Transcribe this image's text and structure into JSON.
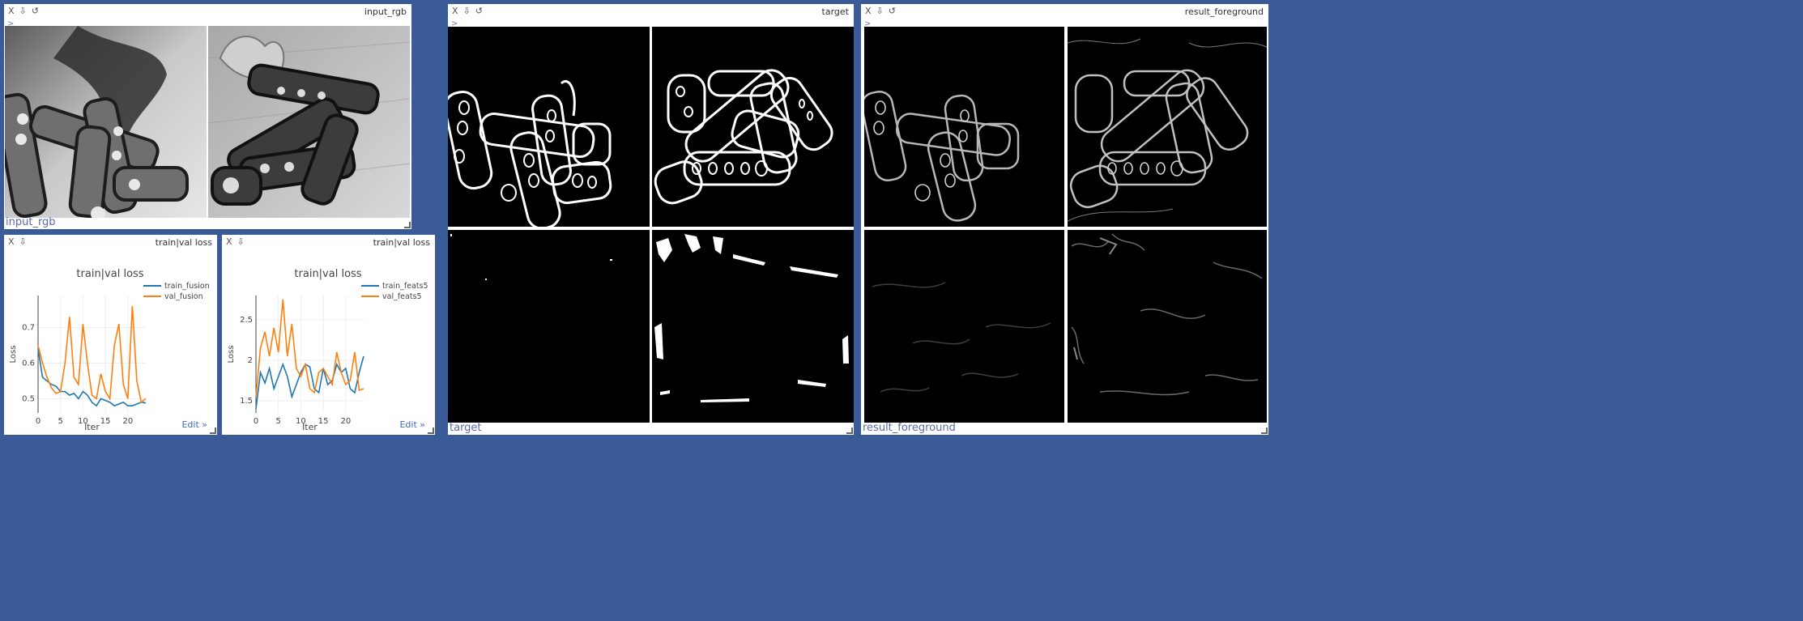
{
  "controls": {
    "close": "X",
    "download": "⇩",
    "reset": "↺",
    "expand": ">"
  },
  "panes": {
    "input_rgb": {
      "title": "input_rgb",
      "caption": "input_rgb"
    },
    "target": {
      "title": "target",
      "caption": "target"
    },
    "result_foreground": {
      "title": "result_foreground",
      "caption": "result_foreground"
    },
    "loss_fusion": {
      "title": "train|val loss",
      "edit_label": "Edit »"
    },
    "loss_feats5": {
      "title": "train|val loss",
      "edit_label": "Edit »"
    }
  },
  "colors": {
    "train": "#1f77b4",
    "val": "#ff7f0e",
    "window_bg": "#3a5a98",
    "caption": "#5a6aa6"
  },
  "chart_data": [
    {
      "type": "line",
      "title": "train|val loss",
      "xlabel": "Iter",
      "ylabel": "Loss",
      "xlim": [
        0,
        24
      ],
      "ylim": [
        0.46,
        0.79
      ],
      "xticks": [
        0,
        5,
        10,
        15,
        20
      ],
      "xtick_labels": [
        "0",
        "5",
        "10",
        "15",
        "20"
      ],
      "yticks": [
        0.5,
        0.6,
        0.7
      ],
      "ytick_labels": [
        "0.5",
        "0.6",
        "0.7"
      ],
      "grid": true,
      "legend_position": "top-right",
      "x": [
        0,
        1,
        2,
        3,
        4,
        5,
        6,
        7,
        8,
        9,
        10,
        11,
        12,
        13,
        14,
        15,
        16,
        17,
        18,
        19,
        20,
        21,
        22,
        23,
        24
      ],
      "series": [
        {
          "name": "train_fusion",
          "color_key": "train",
          "values": [
            0.64,
            0.56,
            0.55,
            0.54,
            0.535,
            0.52,
            0.52,
            0.51,
            0.515,
            0.5,
            0.52,
            0.51,
            0.49,
            0.48,
            0.5,
            0.495,
            0.49,
            0.48,
            0.485,
            0.49,
            0.48,
            0.48,
            0.485,
            0.49,
            0.488
          ]
        },
        {
          "name": "val_fusion",
          "color_key": "val",
          "values": [
            0.65,
            0.6,
            0.56,
            0.53,
            0.515,
            0.52,
            0.6,
            0.73,
            0.56,
            0.54,
            0.71,
            0.6,
            0.51,
            0.5,
            0.57,
            0.52,
            0.5,
            0.65,
            0.71,
            0.54,
            0.5,
            0.76,
            0.55,
            0.49,
            0.5
          ]
        }
      ]
    },
    {
      "type": "line",
      "title": "train|val loss",
      "xlabel": "Iter",
      "ylabel": "Loss",
      "xlim": [
        0,
        24
      ],
      "ylim": [
        1.35,
        2.8
      ],
      "xticks": [
        0,
        5,
        10,
        15,
        20
      ],
      "xtick_labels": [
        "0",
        "5",
        "10",
        "15",
        "20"
      ],
      "yticks": [
        1.5,
        2,
        2.5
      ],
      "ytick_labels": [
        "1.5",
        "2",
        "2.5"
      ],
      "grid": true,
      "legend_position": "top-right",
      "x": [
        0,
        1,
        2,
        3,
        4,
        5,
        6,
        7,
        8,
        9,
        10,
        11,
        12,
        13,
        14,
        15,
        16,
        17,
        18,
        19,
        20,
        21,
        22,
        23,
        24
      ],
      "series": [
        {
          "name": "train_feats5",
          "color_key": "train",
          "values": [
            1.4,
            1.85,
            1.72,
            1.9,
            1.65,
            1.8,
            1.95,
            1.8,
            1.55,
            1.7,
            1.85,
            1.95,
            1.92,
            1.65,
            1.6,
            1.9,
            1.7,
            1.75,
            1.95,
            1.85,
            1.9,
            1.65,
            1.6,
            1.85,
            2.05
          ]
        },
        {
          "name": "val_feats5",
          "color_key": "val",
          "values": [
            1.55,
            2.15,
            2.35,
            2.05,
            2.4,
            2.1,
            2.75,
            2.05,
            2.45,
            1.9,
            1.8,
            1.95,
            1.65,
            1.6,
            1.85,
            1.9,
            1.8,
            1.7,
            2.1,
            1.85,
            1.7,
            1.75,
            2.1,
            1.63,
            1.65
          ]
        }
      ]
    }
  ]
}
